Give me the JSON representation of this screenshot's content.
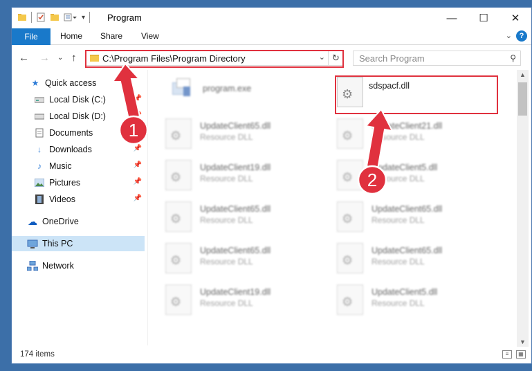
{
  "window": {
    "title": "Program",
    "controls": {
      "minimize": "—",
      "maximize": "☐",
      "close": "✕"
    }
  },
  "ribbon": {
    "file": "File",
    "tabs": [
      "Home",
      "Share",
      "View"
    ],
    "help": "?"
  },
  "address": {
    "path": "C:\\Program Files\\Program Directory"
  },
  "search": {
    "placeholder": "Search Program"
  },
  "sidebar": {
    "items": [
      {
        "label": "Quick access",
        "icon": "star-icon",
        "pinned": false
      },
      {
        "label": "Local Disk (C:)",
        "icon": "drive-icon",
        "pinned": true
      },
      {
        "label": "Local Disk (D:)",
        "icon": "drive-icon",
        "pinned": true
      },
      {
        "label": "Documents",
        "icon": "documents-icon",
        "pinned": true
      },
      {
        "label": "Downloads",
        "icon": "download-icon",
        "pinned": true
      },
      {
        "label": "Music",
        "icon": "music-icon",
        "pinned": true
      },
      {
        "label": "Pictures",
        "icon": "pictures-icon",
        "pinned": true
      },
      {
        "label": "Videos",
        "icon": "videos-icon",
        "pinned": true
      },
      {
        "label": "OneDrive",
        "icon": "cloud-icon",
        "pinned": false
      },
      {
        "label": "This PC",
        "icon": "computer-icon",
        "pinned": false,
        "selected": true
      },
      {
        "label": "Network",
        "icon": "network-icon",
        "pinned": false
      }
    ]
  },
  "files": [
    {
      "name": "program.exe",
      "type": "",
      "blurred": true,
      "icon": "exe-icon"
    },
    {
      "name": "sdspacf.dll",
      "type": "",
      "blurred": false,
      "icon": "dll-icon"
    },
    {
      "name": "UpdateClient65.dll",
      "type": "Resource DLL",
      "blurred": true,
      "icon": "dll-icon"
    },
    {
      "name": "UpdateClient21.dll",
      "type": "Resource DLL",
      "blurred": true,
      "icon": "dll-icon"
    },
    {
      "name": "UpdateClient19.dll",
      "type": "Resource DLL",
      "blurred": true,
      "icon": "dll-icon"
    },
    {
      "name": "UpdateClient5.dll",
      "type": "Resource DLL",
      "blurred": true,
      "icon": "dll-icon"
    },
    {
      "name": "UpdateClient65.dll",
      "type": "Resource DLL",
      "blurred": true,
      "icon": "dll-icon"
    },
    {
      "name": "UpdateClient65.dll",
      "type": "Resource DLL",
      "blurred": true,
      "icon": "dll-icon"
    },
    {
      "name": "UpdateClient65.dll",
      "type": "Resource DLL",
      "blurred": true,
      "icon": "dll-icon"
    },
    {
      "name": "UpdateClient65.dll",
      "type": "Resource DLL",
      "blurred": true,
      "icon": "dll-icon"
    },
    {
      "name": "UpdateClient19.dll",
      "type": "Resource DLL",
      "blurred": true,
      "icon": "dll-icon"
    },
    {
      "name": "UpdateClient5.dll",
      "type": "Resource DLL",
      "blurred": true,
      "icon": "dll-icon"
    }
  ],
  "status": {
    "count": "174 items"
  },
  "annotations": {
    "step1": "1",
    "step2": "2",
    "color": "#e0313e"
  }
}
